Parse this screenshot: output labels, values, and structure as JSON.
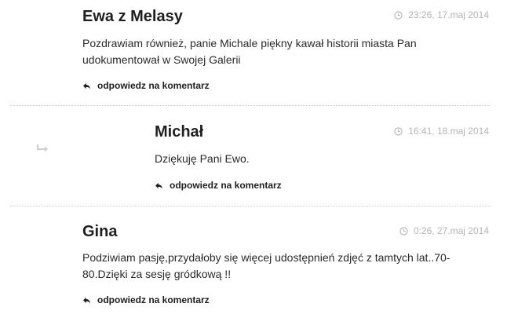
{
  "comments": [
    {
      "author": "Ewa z Melasy",
      "datetime": "23:26, 17.maj 2014",
      "text": "Pozdrawiam również, panie Michale piękny kawał historii miasta Pan udokumentował w Swojej Galerii",
      "reply_label": "odpowiedz na komentarz"
    },
    {
      "author": "Michał",
      "datetime": "16:41, 18.maj 2014",
      "text": "Dziękuję Pani Ewo.",
      "reply_label": "odpowiedz na komentarz"
    },
    {
      "author": "Gina",
      "datetime": "0:26, 27.maj 2014",
      "text": "Podziwiam pasję,przydałoby się więcej udostępnień zdjęć z tamtych lat..70-80.Dzięki za sesję gródkową !!",
      "reply_label": "odpowiedz na komentarz"
    }
  ],
  "icons": {
    "time": "clock-icon",
    "reply": "reply-arrow-icon",
    "nested": "nested-reply-arrow-icon"
  },
  "colors": {
    "text": "#222222",
    "meta": "#b4b4b4",
    "divider": "#c8c8c8",
    "nested_arrow": "#cfcfcf"
  }
}
